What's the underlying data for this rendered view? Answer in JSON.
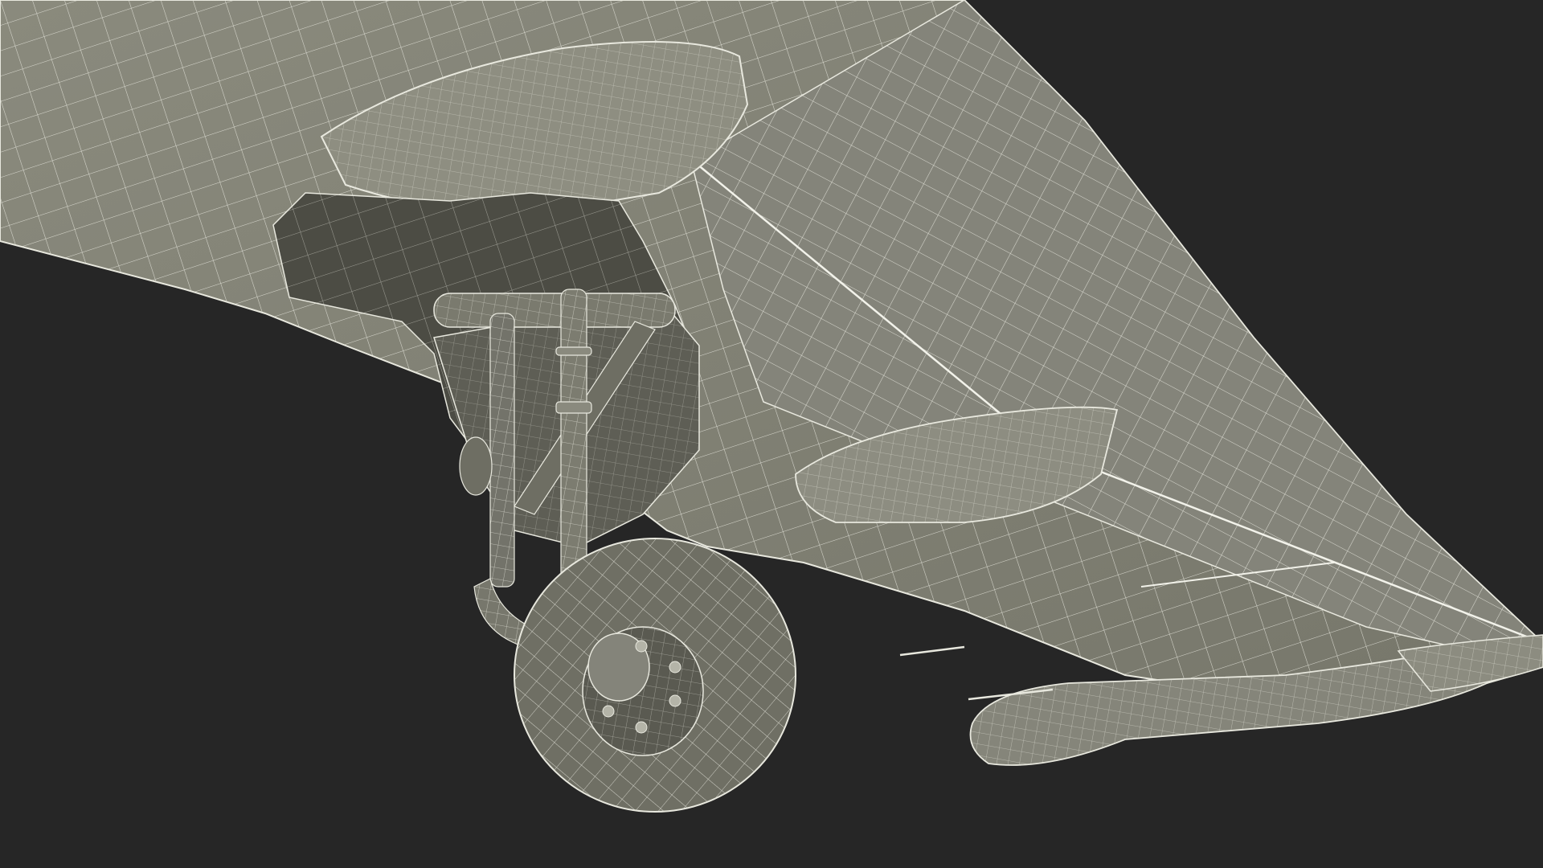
{
  "scene": {
    "subject": "aircraft-wing-underside-wireframe",
    "colors": {
      "background": "#262626",
      "surface": "#7d7d70",
      "surface_light": "#8c8c80",
      "surface_dark": "#55554c",
      "surface_shadow": "#45453d",
      "wire": "#e8e8de"
    }
  }
}
